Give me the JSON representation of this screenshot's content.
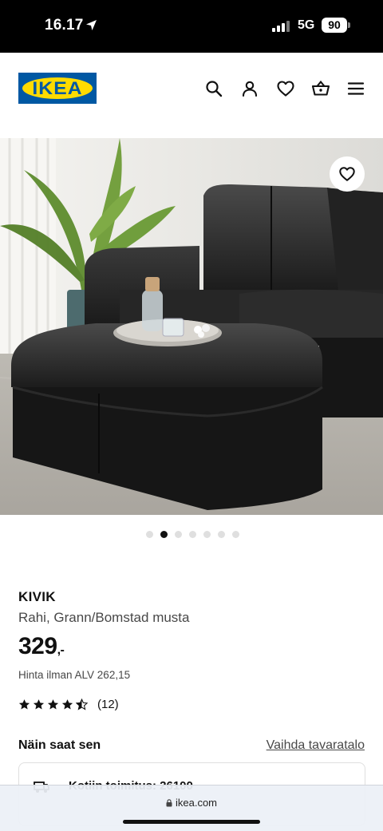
{
  "status": {
    "time": "16.17",
    "network": "5G",
    "battery": "90"
  },
  "header": {
    "logo_text": "IKEA",
    "icons": [
      "search-icon",
      "profile-icon",
      "heart-icon",
      "basket-icon",
      "menu-icon"
    ]
  },
  "gallery": {
    "slide_count": 7,
    "active_index": 1
  },
  "product": {
    "name": "KIVIK",
    "description": "Rahi, Grann/Bomstad musta",
    "price": "329",
    "price_suffix": ",-",
    "vat_text": "Hinta ilman ALV 262,15",
    "rating": 4.5,
    "review_count": "(12)"
  },
  "delivery": {
    "title": "Näin saat sen",
    "change_store_link": "Vaihda tavaratalo",
    "card_text": "Kotiin toimitus: 26100"
  },
  "browser": {
    "url": "ikea.com"
  },
  "colors": {
    "brand_blue": "#0058a3",
    "brand_yellow": "#ffdb00"
  }
}
